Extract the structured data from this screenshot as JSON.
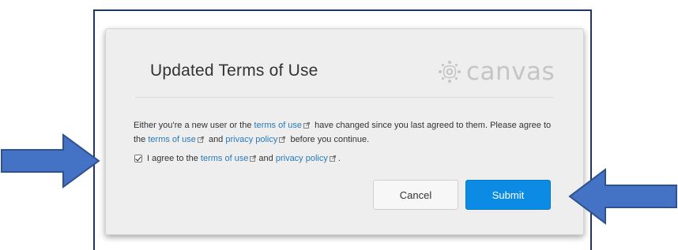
{
  "dialog": {
    "title": "Updated Terms of Use",
    "logo_text": "canvas",
    "logo_icon": "canvas-logo-icon",
    "message": {
      "part1": "Either you're a new user or the ",
      "link1": "terms of use",
      "part2": " have changed since you last agreed to them. Please agree to the ",
      "link2": "terms of use",
      "part3": " and ",
      "link3": "privacy policy",
      "part4": " before you continue."
    },
    "agreement": {
      "checked": true,
      "prefix": "I agree to the ",
      "link1": "terms of use",
      "middle": " and ",
      "link2": "privacy policy",
      "suffix": " ."
    },
    "cancel_label": "Cancel",
    "submit_label": "Submit"
  },
  "colors": {
    "link": "#2a7ab8",
    "submit": "#0b8be3",
    "arrow": "#4472c4",
    "arrow_border": "#2f528f",
    "frame": "#1f3763"
  },
  "annotations": {
    "left_arrow": "right-pointing-arrow",
    "right_arrow": "left-pointing-arrow"
  }
}
